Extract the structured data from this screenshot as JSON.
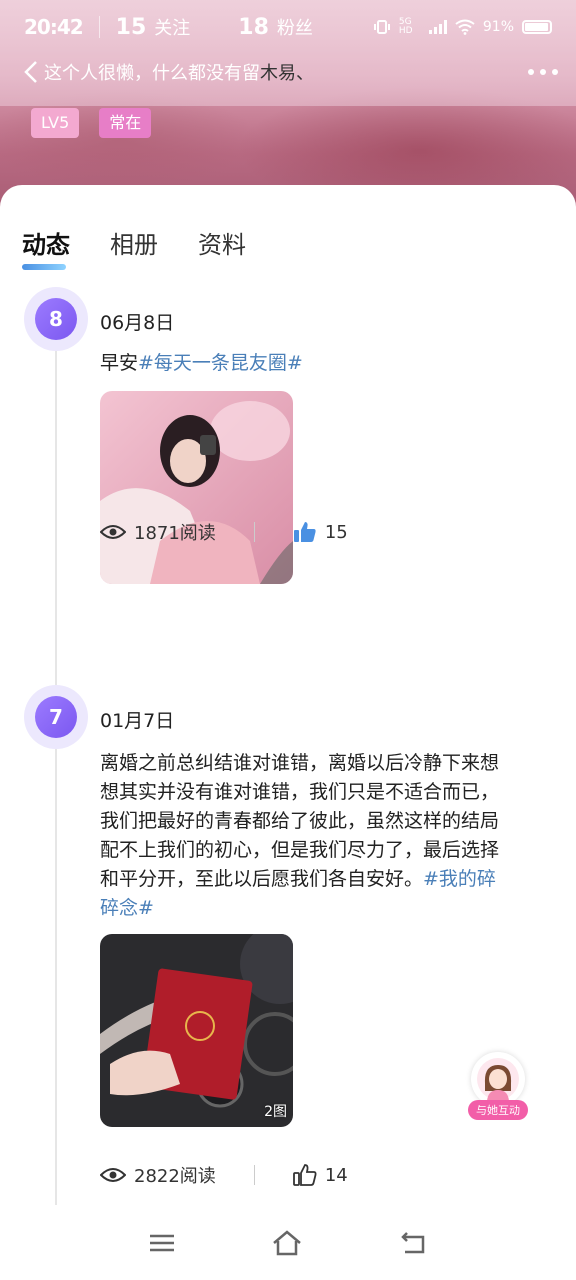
{
  "status_bar": {
    "time": "20:42",
    "network": "5G HD",
    "battery": "91%"
  },
  "header": {
    "stats": [
      {
        "num": "15",
        "label": "关注"
      },
      {
        "num": "18",
        "label": "粉丝"
      }
    ],
    "bio": "这个人很懒，什么都没有留",
    "nickname": "木易、",
    "tags": [
      "LV5",
      "常在"
    ]
  },
  "tabs": [
    "动态",
    "相册",
    "资料"
  ],
  "posts": [
    {
      "day": "8",
      "date": "06月8日",
      "text": "早安",
      "hashtag": "#每天一条昆友圈#",
      "views": "1871阅读",
      "likes": "15",
      "liked": true
    },
    {
      "day": "7",
      "date": "01月7日",
      "text": "离婚之前总纠结谁对谁错，离婚以后冷静下来想想其实并没有谁对谁错，我们只是不适合而已，我们把最好的青春都给了彼此，虽然这样的结局配不上我们的初心，但是我们尽力了，最后选择和平分开，至此以后愿我们各自安好。",
      "hashtag": "#我的碎碎念#",
      "image_count": "2图",
      "views": "2822阅读",
      "likes": "14",
      "liked": false
    }
  ],
  "interact": {
    "label": "与她互动"
  },
  "colors": {
    "accent": "#7b58f0",
    "hashtag": "#4a7fb8",
    "like": "#4a90e2",
    "tag_lv": "#f3a9d0",
    "tag_on": "#e77ec7"
  }
}
